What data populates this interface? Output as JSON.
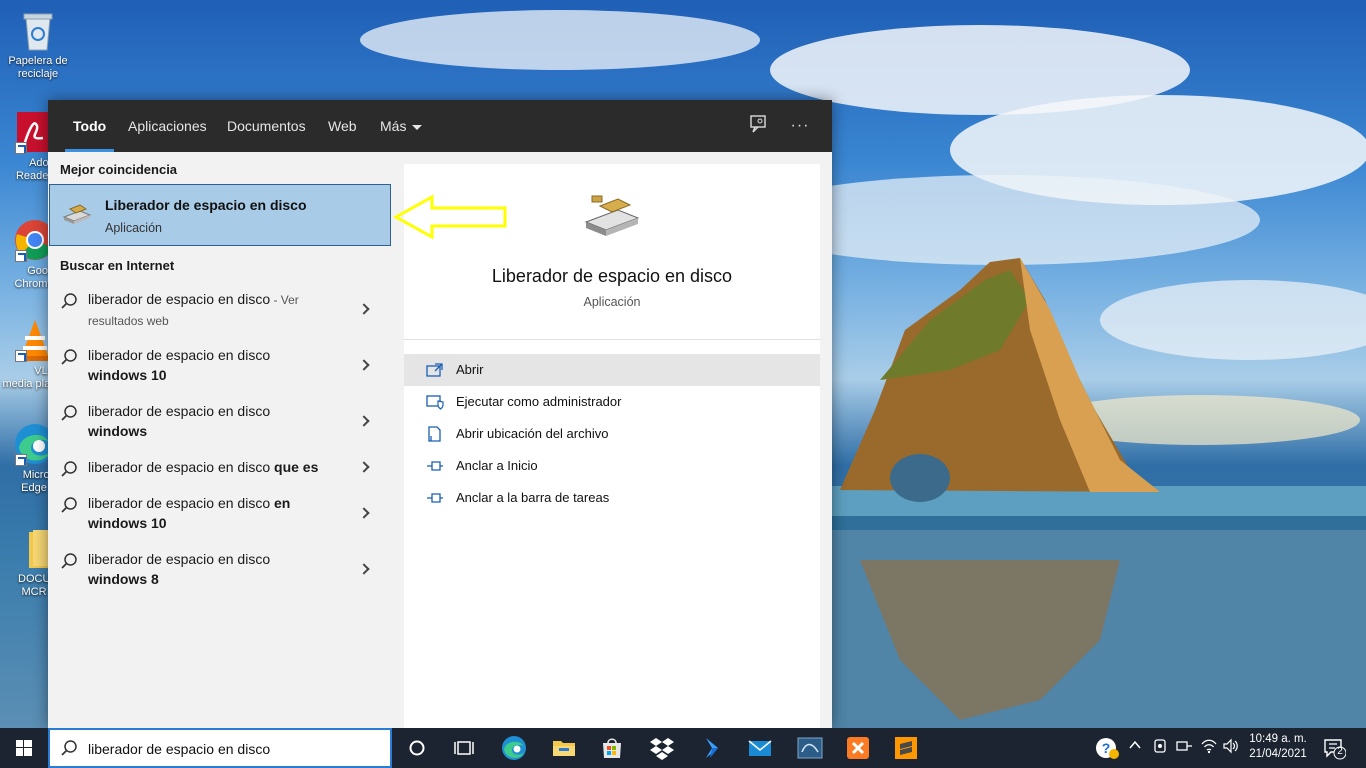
{
  "desktop": {
    "icons": [
      {
        "label": "Papelera de reciclaje",
        "icon": "recycle-bin-icon"
      },
      {
        "label": "Adobe Reader",
        "icon": "adobe-reader-icon"
      },
      {
        "label": "Google Chrome",
        "icon": "chrome-icon"
      },
      {
        "label": "VLC media player",
        "icon": "vlc-icon"
      },
      {
        "label": "Microsoft Edge",
        "icon": "edge-icon"
      },
      {
        "label": "DOCUMENTOS MCR",
        "icon": "folder-icon"
      }
    ]
  },
  "search": {
    "tabs": [
      {
        "label": "Todo",
        "active": true
      },
      {
        "label": "Aplicaciones"
      },
      {
        "label": "Documentos"
      },
      {
        "label": "Web"
      },
      {
        "label": "Más"
      }
    ],
    "tools": [
      "feedback-icon",
      "more-options-icon"
    ],
    "best_match_heading": "Mejor coincidencia",
    "best_match": {
      "title": "Liberador de espacio en disco",
      "subtitle": "Aplicación"
    },
    "web_heading": "Buscar en Internet",
    "web_results": [
      {
        "text": "liberador de espacio en disco",
        "bold": "",
        "hint": " - Ver resultados web"
      },
      {
        "text": "liberador de espacio en disco ",
        "bold": "windows 10",
        "hint": ""
      },
      {
        "text": "liberador de espacio en disco ",
        "bold": "windows",
        "hint": ""
      },
      {
        "text": "liberador de espacio en disco ",
        "bold": "que es",
        "hint": ""
      },
      {
        "text": "liberador de espacio en disco ",
        "bold": "en windows 10",
        "hint": ""
      },
      {
        "text": "liberador de espacio en disco ",
        "bold": "windows 8",
        "hint": ""
      }
    ],
    "preview": {
      "title": "Liberador de espacio en disco",
      "subtitle": "Aplicación",
      "actions": [
        {
          "label": "Abrir",
          "icon": "open-icon"
        },
        {
          "label": "Ejecutar como administrador",
          "icon": "shield-icon"
        },
        {
          "label": "Abrir ubicación del archivo",
          "icon": "file-location-icon"
        },
        {
          "label": "Anclar a Inicio",
          "icon": "pin-icon"
        },
        {
          "label": "Anclar a la barra de tareas",
          "icon": "pin-icon"
        }
      ]
    },
    "query": "liberador de espacio en disco"
  },
  "taskbar": {
    "pinned": [
      "cortana-icon",
      "task-view-icon",
      "edge-icon",
      "file-explorer-icon",
      "store-icon",
      "dropbox-icon",
      "visual-studio-icon",
      "mail-icon",
      "mysql-workbench-icon",
      "xampp-icon",
      "sublime-text-icon"
    ],
    "time": "10:49 a. m.",
    "date": "21/04/2021",
    "notifications": "2"
  },
  "colors": {
    "accent": "#3a91e0",
    "selection": "#a8cbe8",
    "tabbar": "#2b2b2b",
    "taskbar": "#1b2430",
    "callout": "#ffff00"
  }
}
